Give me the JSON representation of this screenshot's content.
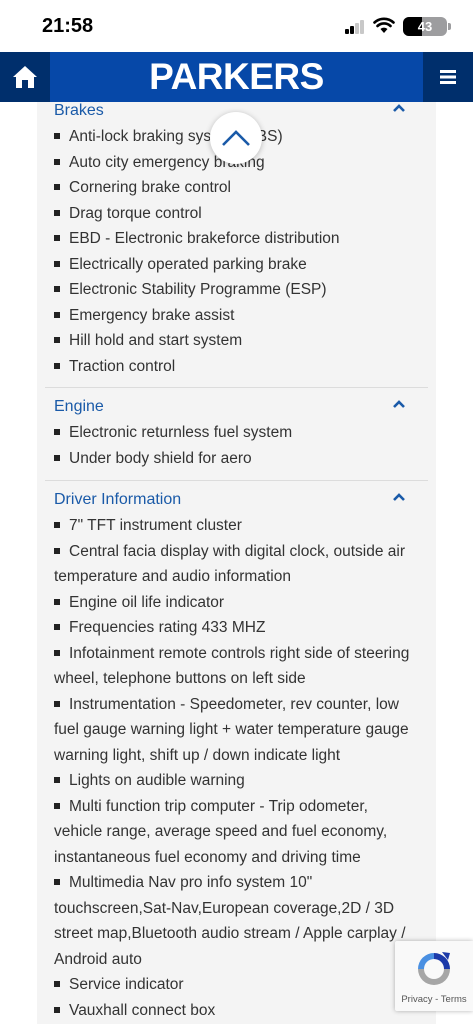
{
  "status_bar": {
    "time": "21:58",
    "battery": "43",
    "battery_level": 0.43,
    "icons": [
      "cellular-signal-icon",
      "wifi-icon",
      "battery-icon"
    ]
  },
  "header": {
    "brand": "PARKERS",
    "home_icon": "home-icon",
    "menu_icon": "hamburger-menu-icon",
    "colors": {
      "bar": "#0648a8",
      "side_buttons": "#002f6c"
    }
  },
  "sections": [
    {
      "title": "Brakes",
      "items": [
        "Anti-lock braking system (ABS)",
        "Auto city emergency braking",
        "Cornering brake control",
        "Drag torque control",
        "EBD - Electronic brakeforce distribution",
        "Electrically operated parking brake",
        "Electronic Stability Programme (ESP)",
        "Emergency brake assist",
        "Hill hold and start system",
        "Traction control"
      ]
    },
    {
      "title": "Engine",
      "items": [
        "Electronic returnless fuel system",
        "Under body shield for aero"
      ]
    },
    {
      "title": "Driver Information",
      "items": [
        "7\" TFT instrument cluster",
        "Central facia display with digital clock, outside air temperature and audio information",
        "Engine oil life indicator",
        "Frequencies rating 433 MHZ",
        "Infotainment remote controls right side of steering wheel, telephone buttons on left side",
        "Instrumentation - Speedometer, rev counter, low fuel gauge warning light + water temperature gauge warning light, shift up / down indicate light",
        "Lights on audible warning",
        "Multi function trip computer - Trip odometer, vehicle range, average speed and fuel economy, instantaneous fuel economy and driving time",
        "Multimedia Nav pro info system 10\" touchscreen,Sat-Nav,European coverage,2D / 3D street map,Bluetooth audio stream / Apple carplay / Android auto",
        "Service indicator",
        "Vauxhall connect box"
      ]
    }
  ],
  "scroll_top_icon": "chevron-up-icon",
  "recaptcha": {
    "privacy": "Privacy",
    "separator": "-",
    "terms": "Terms"
  },
  "accent_colors": {
    "section_title": "#1a5aa8",
    "chevron": "#1a5aa8"
  }
}
